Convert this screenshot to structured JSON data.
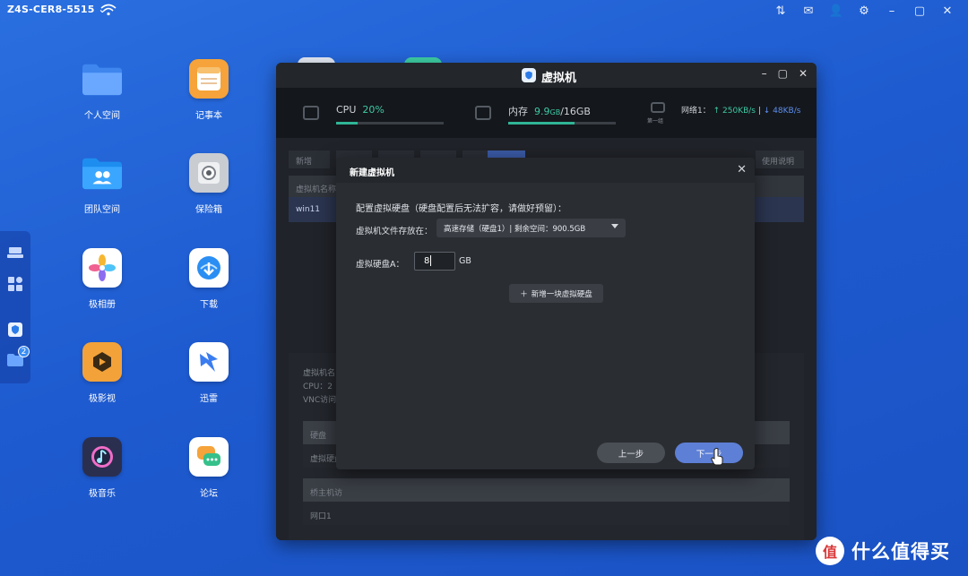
{
  "topbar": {
    "device_name": "Z4S-CER8-5515",
    "icons": [
      "sort-icon",
      "mail-icon",
      "user-icon",
      "gear-icon",
      "minimize-icon",
      "maximize-icon",
      "close-icon"
    ]
  },
  "dock": {
    "badge": "2",
    "icons": [
      "drive-icon",
      "apps-grid-icon",
      "vm-shield-icon",
      "folder-icon"
    ]
  },
  "apps": [
    {
      "label": "个人空间",
      "icon": "folder-icon",
      "color": "#4a90f0"
    },
    {
      "label": "记事本",
      "icon": "notepad-icon",
      "color": "#f5a33a"
    },
    {
      "label": "团队空间",
      "icon": "team-folder-icon",
      "color": "#2b9af3"
    },
    {
      "label": "保险箱",
      "icon": "safe-icon",
      "color": "#c9ccd1"
    },
    {
      "label": "极相册",
      "icon": "photos-icon",
      "color": "#ffffff"
    },
    {
      "label": "下载",
      "icon": "download-icon",
      "color": "#ffffff"
    },
    {
      "label": "极影视",
      "icon": "video-icon",
      "color": "#f3a23a"
    },
    {
      "label": "迅雷",
      "icon": "thunder-icon",
      "color": "#ffffff"
    },
    {
      "label": "极音乐",
      "icon": "music-icon",
      "color": "#2a2f4f"
    },
    {
      "label": "论坛",
      "icon": "forum-icon",
      "color": "#ffffff"
    }
  ],
  "vm_window": {
    "title": "虚拟机",
    "stats": {
      "cpu_label": "CPU",
      "cpu_value": "20%",
      "cpu_percent": 20,
      "mem_label": "内存",
      "mem_value": "9.9",
      "mem_unit": "GB",
      "mem_total": "/16GB",
      "mem_percent": 62,
      "net_label": "网络1：",
      "net_up": "↑ 250KB/s",
      "net_down": "↓ 48KB/s",
      "net_icon_caption": "第一组"
    },
    "background": {
      "new_button": "新增",
      "help_button": "使用说明",
      "col_vm_name": "虚拟机名称",
      "row_vm": "win11",
      "detail_name": "虚拟机名",
      "detail_cpu": "CPU：2",
      "detail_vnc": "VNC访问",
      "section_disk": "硬盘",
      "row_disk": "虚拟硬盘",
      "section_bridge": "桥主机访",
      "row_port": "网口1"
    }
  },
  "dialog": {
    "title": "新建虚拟机",
    "section": "配置虚拟硬盘（硬盘配置后无法扩容，请做好预留）：",
    "storage_label": "虚拟机文件存放在：",
    "storage_value": "高速存储（硬盘1）| 剩余空间：900.5GB",
    "disk_label": "虚拟硬盘A：",
    "disk_value": "8",
    "disk_unit": "GB",
    "add_disk": "新增一块虚拟硬盘",
    "prev_button": "上一步",
    "next_button": "下一步"
  },
  "watermark": {
    "text": "什么值得买",
    "logo_char": "值"
  }
}
